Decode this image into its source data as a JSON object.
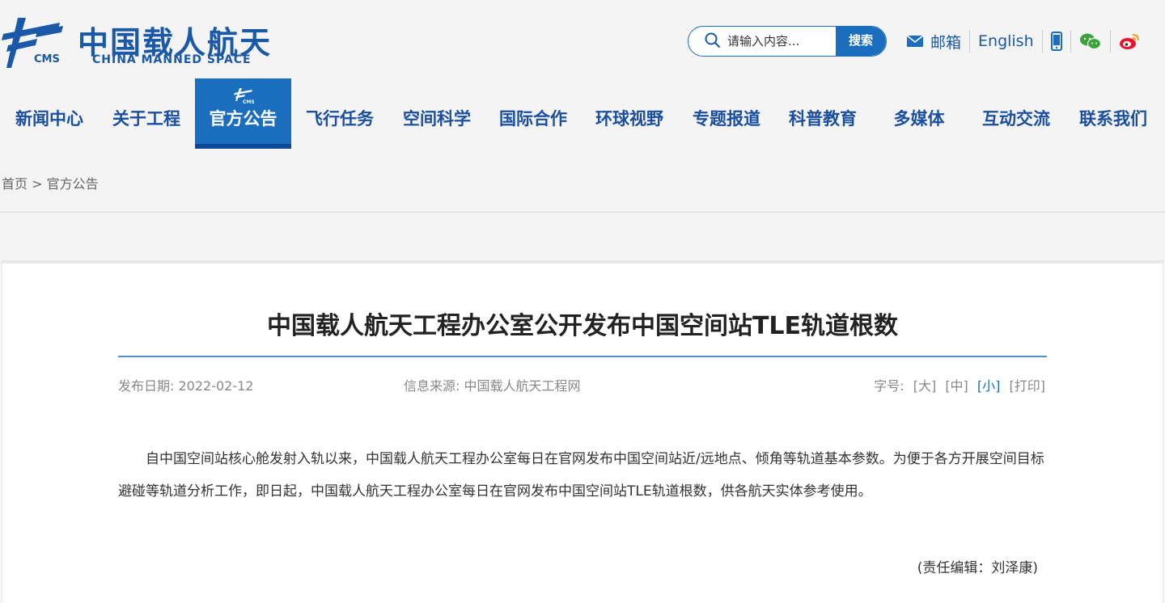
{
  "header": {
    "logo_cn": "中国载人航天",
    "logo_en": "CHINA MANNED SPACE",
    "logo_abbr": "CMS",
    "search_placeholder": "请输入内容...",
    "search_button": "搜索",
    "mail_label": "邮箱",
    "english_label": "English",
    "icons": [
      "mail-icon",
      "mobile-icon",
      "wechat-icon",
      "weibo-icon"
    ]
  },
  "nav": {
    "items": [
      {
        "label": "新闻中心"
      },
      {
        "label": "关于工程"
      },
      {
        "label": "官方公告",
        "active": true
      },
      {
        "label": "飞行任务"
      },
      {
        "label": "空间科学"
      },
      {
        "label": "国际合作"
      },
      {
        "label": "环球视野"
      },
      {
        "label": "专题报道"
      },
      {
        "label": "科普教育"
      },
      {
        "label": "多媒体"
      },
      {
        "label": "互动交流"
      },
      {
        "label": "联系我们"
      }
    ]
  },
  "breadcrumb": {
    "home": "首页",
    "separator": ">",
    "current": "官方公告"
  },
  "article": {
    "title": "中国载人航天工程办公室公开发布中国空间站TLE轨道根数",
    "date": "发布日期: 2022-02-12",
    "source": "信息来源: 中国载人航天工程网",
    "font_size_label": "字号:",
    "font_size_options": [
      "[大]",
      "[中]",
      "[小]",
      "[打印]"
    ],
    "body": "自中国空间站核心舱发射入轨以来，中国载人航天工程办公室每日在官网发布中国空间站近/远地点、倾角等轨道基本参数。为便于各方开展空间目标避碰等轨道分析工作，即日起，中国载人航天工程办公室每日在官网发布中国空间站TLE轨道根数，供各航天实体参考使用。",
    "editor": "(责任编辑：刘泽康)"
  },
  "colors": {
    "brand": "#1a58a8",
    "accent": "#1a6ebd",
    "background": "#f4f4f4"
  }
}
